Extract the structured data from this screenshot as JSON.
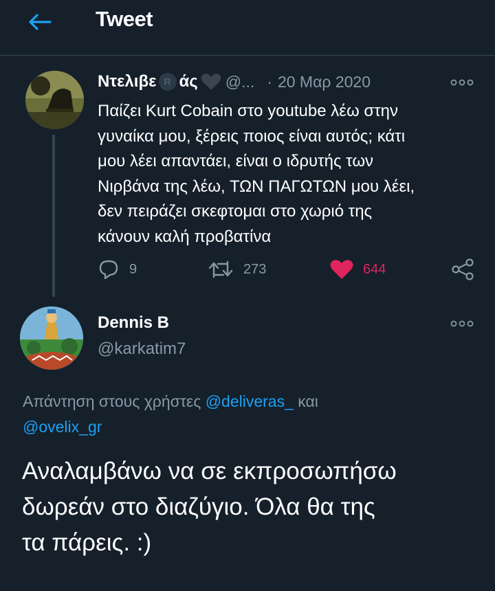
{
  "header": {
    "title": "Tweet"
  },
  "original_tweet": {
    "author_name_start": "Ντελιβε",
    "author_badge": "R",
    "author_name_end": "άς",
    "handle": "@...",
    "separator": "·",
    "date": "20 Μαρ 2020",
    "text": "Παίζει Kurt Cobain στο youtube λέω στην\nγυναίκα μου, ξέρεις ποιος είναι αυτός; κάτι\nμου λέει απαντάει, είναι ο ιδρυτής των\nΝιρβάνα της λέω, ΤΩΝ ΠΑΓΩΤΩΝ μου λέει,\nδεν πειράζει σκεφτομαι στο χωριό της\nκάνουν καλή προβατίνα",
    "replies": "9",
    "retweets": "273",
    "likes": "644"
  },
  "reply_tweet": {
    "author_name": "Dennis B",
    "handle": "@karkatim7",
    "replying_to_prefix": "Απάντηση στους χρήστες",
    "mention_1": "@deliveras_",
    "conjunction": "και",
    "mention_2": "@ovelix_gr",
    "text": "Αναλαμβάνω να σε εκπροσωπήσω\nδωρεάν στο διαζύγιο. Όλα θα της\nτα πάρεις. :)"
  },
  "colors": {
    "background": "#15202b",
    "text_secondary": "#8899a6",
    "accent": "#1da1f2",
    "like": "#e0245e",
    "divider": "#38444d"
  },
  "icons": {
    "back": "arrow-left-icon",
    "more": "more-options-icon",
    "reply": "reply-icon",
    "retweet": "retweet-icon",
    "like": "heart-filled-icon",
    "share": "share-icon",
    "name_heart": "heart-emoji-icon"
  }
}
